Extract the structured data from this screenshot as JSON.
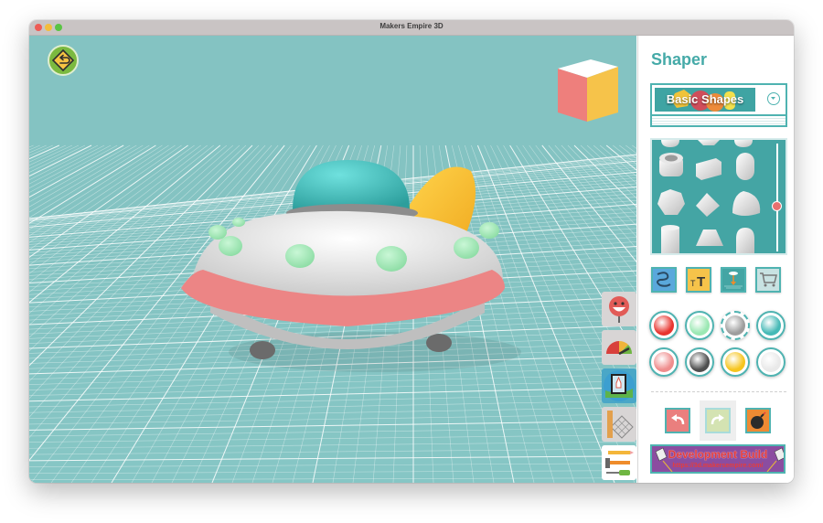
{
  "window": {
    "title": "Makers Empire 3D",
    "controls": [
      "close",
      "minimize",
      "maximize"
    ]
  },
  "viewport": {
    "home_button_icon": "return-arrow-sign-icon",
    "view_cube": {
      "faces": {
        "top": "#ffffff",
        "left": "#ee7f7c",
        "right": "#f6c34a"
      }
    },
    "scene_object": "ufo-model",
    "colors": {
      "background": "#84c3c2",
      "grid": "#ffffff"
    },
    "side_tools": [
      {
        "name": "emoji-tool",
        "icon": "smiley-face-icon",
        "active": false
      },
      {
        "name": "gauge-tool",
        "icon": "speedometer-icon",
        "active": false
      },
      {
        "name": "gallery-tool",
        "icon": "rocket-picture-icon",
        "active": false
      },
      {
        "name": "grid-measure-tool",
        "icon": "ruler-grid-icon",
        "active": false
      },
      {
        "name": "build-tools",
        "icon": "pencil-hammer-screwdriver-icon",
        "active": true
      }
    ]
  },
  "panel": {
    "title": "Shaper",
    "category": {
      "label": "Basic Shapes",
      "icon": "chevron-down-circle-icon"
    },
    "shapes": [
      "half-sphere",
      "wedge-top",
      "capsule-top",
      "tube",
      "box",
      "capsule",
      "icosahedron",
      "octahedron",
      "teardrop",
      "cylinder",
      "frustum",
      "dome"
    ],
    "slider_value": 0.58,
    "tools": [
      {
        "name": "freehand-tool",
        "icon": "squiggle-icon",
        "color": "#5aa8dc"
      },
      {
        "name": "text-tool",
        "icon": "text-tt-icon",
        "color": "#f6c34a"
      },
      {
        "name": "drop-to-floor-tool",
        "icon": "drop-arrow-icon",
        "color": "#44a5a4"
      },
      {
        "name": "shop-tool",
        "icon": "shopping-cart-icon",
        "color": "#c8e2e2"
      }
    ],
    "swatches": [
      {
        "name": "red",
        "color": "#e8352f",
        "selected": false
      },
      {
        "name": "mint",
        "color": "#9be8b3",
        "selected": false
      },
      {
        "name": "gray",
        "color": "#9d9d9d",
        "selected": true
      },
      {
        "name": "teal",
        "color": "#45b9b6",
        "selected": false
      },
      {
        "name": "pink",
        "color": "#ef8d8d",
        "selected": false
      },
      {
        "name": "charcoal",
        "color": "#4f4f4f",
        "selected": false
      },
      {
        "name": "yellow",
        "color": "#f6c51f",
        "selected": false
      },
      {
        "name": "white",
        "color": "#e9e9e9",
        "selected": false
      }
    ],
    "actions": [
      {
        "name": "undo",
        "icon": "undo-arrow-icon",
        "color": "#ea7f7e"
      },
      {
        "name": "redo",
        "icon": "redo-arrow-icon",
        "color": "#d4e3b2"
      },
      {
        "name": "delete-all",
        "icon": "bomb-icon",
        "color": "#ed8a33"
      }
    ],
    "dev_banner": {
      "title": "Development Build",
      "url": "https://3d.makersempire.com/"
    }
  }
}
